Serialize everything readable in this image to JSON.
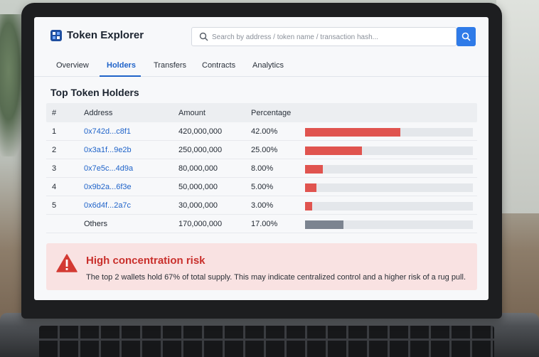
{
  "app": {
    "brand": "Token Explorer"
  },
  "search": {
    "placeholder": "Search by address / token name / transaction hash..."
  },
  "tabs": [
    {
      "label": "Overview",
      "active": false
    },
    {
      "label": "Holders",
      "active": true
    },
    {
      "label": "Transfers",
      "active": false
    },
    {
      "label": "Contracts",
      "active": false
    },
    {
      "label": "Analytics",
      "active": false
    }
  ],
  "holders": {
    "title": "Top Token Holders",
    "columns": {
      "rank": "#",
      "address": "Address",
      "amount": "Amount",
      "percentage": "Percentage"
    },
    "rows": [
      {
        "rank": "1",
        "address": "0x742d...c8f1",
        "amount": "420,000,000",
        "percentage": "42.00%",
        "share": 0.42
      },
      {
        "rank": "2",
        "address": "0x3a1f...9e2b",
        "amount": "250,000,000",
        "percentage": "25.00%",
        "share": 0.25
      },
      {
        "rank": "3",
        "address": "0x7e5c...4d9a",
        "amount": "80,000,000",
        "percentage": "8.00%",
        "share": 0.08
      },
      {
        "rank": "4",
        "address": "0x9b2a...6f3e",
        "amount": "50,000,000",
        "percentage": "5.00%",
        "share": 0.05
      },
      {
        "rank": "5",
        "address": "0x6d4f...2a7c",
        "amount": "30,000,000",
        "percentage": "3.00%",
        "share": 0.03
      },
      {
        "rank": "",
        "address": "Others",
        "amount": "170,000,000",
        "percentage": "17.00%",
        "share": 0.17
      }
    ]
  },
  "alert": {
    "title": "High concentration risk",
    "body": "The top 2 wallets hold 67% of total supply. This may indicate centralized control and a higher risk of a rug pull."
  },
  "colors": {
    "accent": "#1f63c9",
    "search_button": "#2f7be8",
    "bar_holder": "#e0544f",
    "bar_others": "#7c8490",
    "alert_bg": "#f9e2e2",
    "alert_text": "#c9302c"
  },
  "icons": {
    "logo": "token-cube-icon",
    "search": "search-icon",
    "alert": "warning-triangle-icon"
  }
}
